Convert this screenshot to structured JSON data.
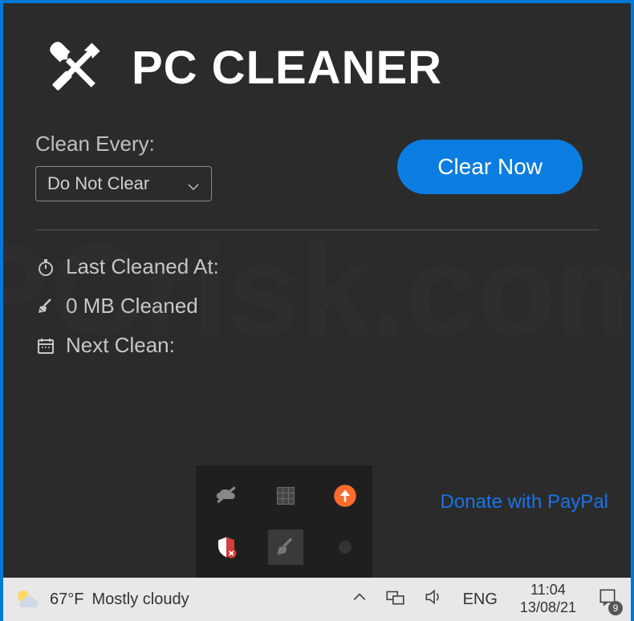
{
  "app": {
    "title": "PC CLEANER"
  },
  "controls": {
    "clean_every_label": "Clean Every:",
    "dropdown_value": "Do Not Clear",
    "clear_button": "Clear Now"
  },
  "stats": {
    "last_cleaned": "Last Cleaned At:",
    "mb_cleaned": "0 MB Cleaned",
    "next_clean": "Next Clean:"
  },
  "donate": {
    "label": "Donate with PayPal"
  },
  "taskbar": {
    "weather_temp": "67°F",
    "weather_cond": "Mostly cloudy",
    "lang": "ENG",
    "time": "11:04",
    "date": "13/08/21",
    "notif_count": "9"
  },
  "watermark": "PCrisk.com"
}
